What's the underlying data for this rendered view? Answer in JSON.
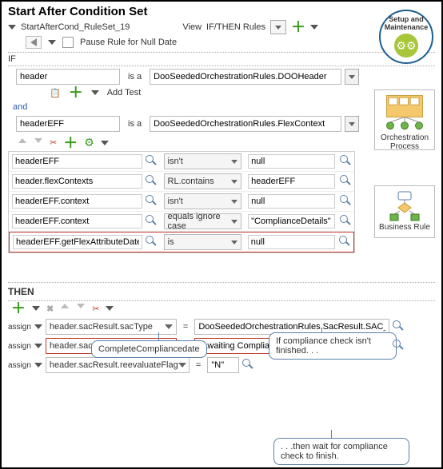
{
  "header": {
    "title": "Start After Condition Set",
    "ruleset_name": "StartAfterCond_RuleSet_19",
    "view_label": "View",
    "view_value": "IF/THEN Rules",
    "pause_label": "Pause Rule for Null Date"
  },
  "badge": {
    "title": "Setup and Maintenance"
  },
  "side": {
    "orch": "Orchestration Process",
    "br": "Business Rule"
  },
  "if": {
    "label": "IF",
    "row1_var": "header",
    "isa": "is a",
    "row1_type": "DooSeededOrchestrationRules.DOOHeader",
    "add_test": "Add Test",
    "and": "and",
    "row2_var": "headerEFF",
    "row2_type": "DooSeededOrchestrationRules.FlexContext",
    "rows": [
      {
        "lhs": "headerEFF",
        "op": "isn't",
        "rhs": "null"
      },
      {
        "lhs": "header.flexContexts",
        "op": "RL.contains",
        "rhs": "headerEFF"
      },
      {
        "lhs": "headerEFF.context",
        "op": "isn't",
        "rhs": "null"
      },
      {
        "lhs": "headerEFF.context",
        "op": "equals ignore case",
        "rhs": "\"ComplianceDetails\""
      },
      {
        "lhs": "headerEFF.getFlexAttributeDateValue(\"_CompleteCompliancedate\")",
        "op": "is",
        "rhs": "null"
      }
    ]
  },
  "then": {
    "label": "THEN",
    "assign": "assign",
    "rows": [
      {
        "var": "header.sacResult.sacType",
        "val": "DooSeededOrchestrationRules.SacResult.SAC_TYPE_EVENT"
      },
      {
        "var": "header.sacResult.eventName",
        "val": "\"Awaiting Compliance Check Completion\""
      },
      {
        "var": "header.sacResult.reevaluateFlag",
        "val": "\"N\""
      }
    ],
    "eq": "="
  },
  "callouts": {
    "c1": "CompleteCompliancedate",
    "c2": "If compliance check isn't finished. . .",
    "c3": ". . .then wait for compliance check to finish."
  }
}
